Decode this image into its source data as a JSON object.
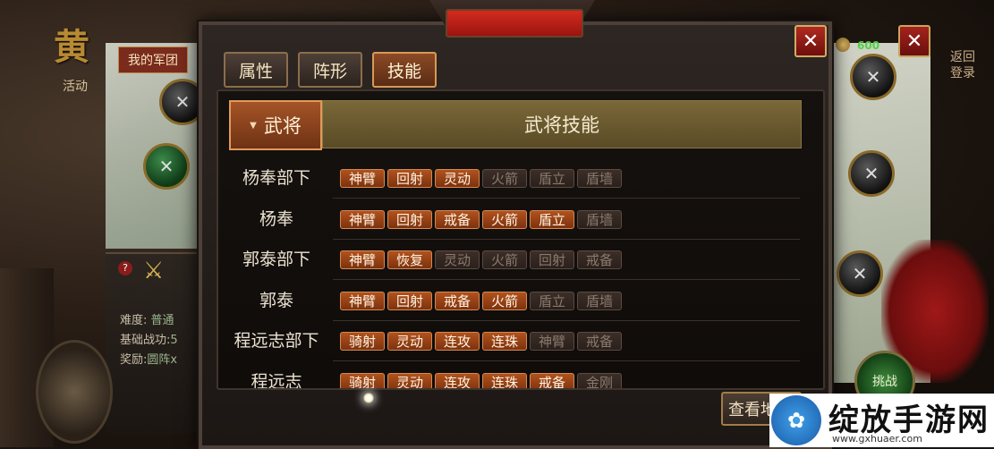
{
  "background": {
    "top_left_glyph": "黄",
    "activity_label": "活动",
    "my_army_button": "我的军团",
    "return_button": "返回\n登录",
    "coin_count": "600",
    "fight_button": "挑战",
    "difficulty_label": "难度:",
    "difficulty_value": "普通",
    "base_power_label": "基础战功:",
    "base_power_value": "5",
    "reward_label": "奖励:",
    "reward_value": "圆阵x"
  },
  "dialog": {
    "tabs": [
      {
        "label": "属性",
        "active": false
      },
      {
        "label": "阵形",
        "active": false
      },
      {
        "label": "技能",
        "active": true
      }
    ],
    "header": {
      "general_label": "武将",
      "skill_label": "武将技能"
    },
    "rows": [
      {
        "name": "杨奉部下",
        "skills": [
          {
            "label": "神臂",
            "on": true
          },
          {
            "label": "回射",
            "on": true
          },
          {
            "label": "灵动",
            "on": true
          },
          {
            "label": "火箭",
            "on": false
          },
          {
            "label": "盾立",
            "on": false
          },
          {
            "label": "盾墙",
            "on": false
          }
        ]
      },
      {
        "name": "杨奉",
        "skills": [
          {
            "label": "神臂",
            "on": true
          },
          {
            "label": "回射",
            "on": true
          },
          {
            "label": "戒备",
            "on": true
          },
          {
            "label": "火箭",
            "on": true
          },
          {
            "label": "盾立",
            "on": true
          },
          {
            "label": "盾墙",
            "on": false
          }
        ]
      },
      {
        "name": "郭泰部下",
        "skills": [
          {
            "label": "神臂",
            "on": true
          },
          {
            "label": "恢复",
            "on": true
          },
          {
            "label": "灵动",
            "on": false
          },
          {
            "label": "火箭",
            "on": false
          },
          {
            "label": "回射",
            "on": false
          },
          {
            "label": "戒备",
            "on": false
          }
        ]
      },
      {
        "name": "郭泰",
        "skills": [
          {
            "label": "神臂",
            "on": true
          },
          {
            "label": "回射",
            "on": true
          },
          {
            "label": "戒备",
            "on": true
          },
          {
            "label": "火箭",
            "on": true
          },
          {
            "label": "盾立",
            "on": false
          },
          {
            "label": "盾墙",
            "on": false
          }
        ]
      },
      {
        "name": "程远志部下",
        "skills": [
          {
            "label": "骑射",
            "on": true
          },
          {
            "label": "灵动",
            "on": true
          },
          {
            "label": "连攻",
            "on": true
          },
          {
            "label": "连珠",
            "on": true
          },
          {
            "label": "神臂",
            "on": false
          },
          {
            "label": "戒备",
            "on": false
          }
        ]
      },
      {
        "name": "程远志",
        "skills": [
          {
            "label": "骑射",
            "on": true
          },
          {
            "label": "灵动",
            "on": true
          },
          {
            "label": "连攻",
            "on": true
          },
          {
            "label": "连珠",
            "on": true
          },
          {
            "label": "戒备",
            "on": true
          },
          {
            "label": "金刚",
            "on": false
          }
        ]
      }
    ],
    "check_button": "查看地"
  },
  "watermark": {
    "title": "绽放手游网",
    "url": "www.gxhuaer.com"
  },
  "colors": {
    "skill_on": "#b0521e",
    "skill_off": "#3c2e28",
    "tab_active": "#8c4a26",
    "header_bar": "#7a6838",
    "close_red": "#b02a20"
  }
}
